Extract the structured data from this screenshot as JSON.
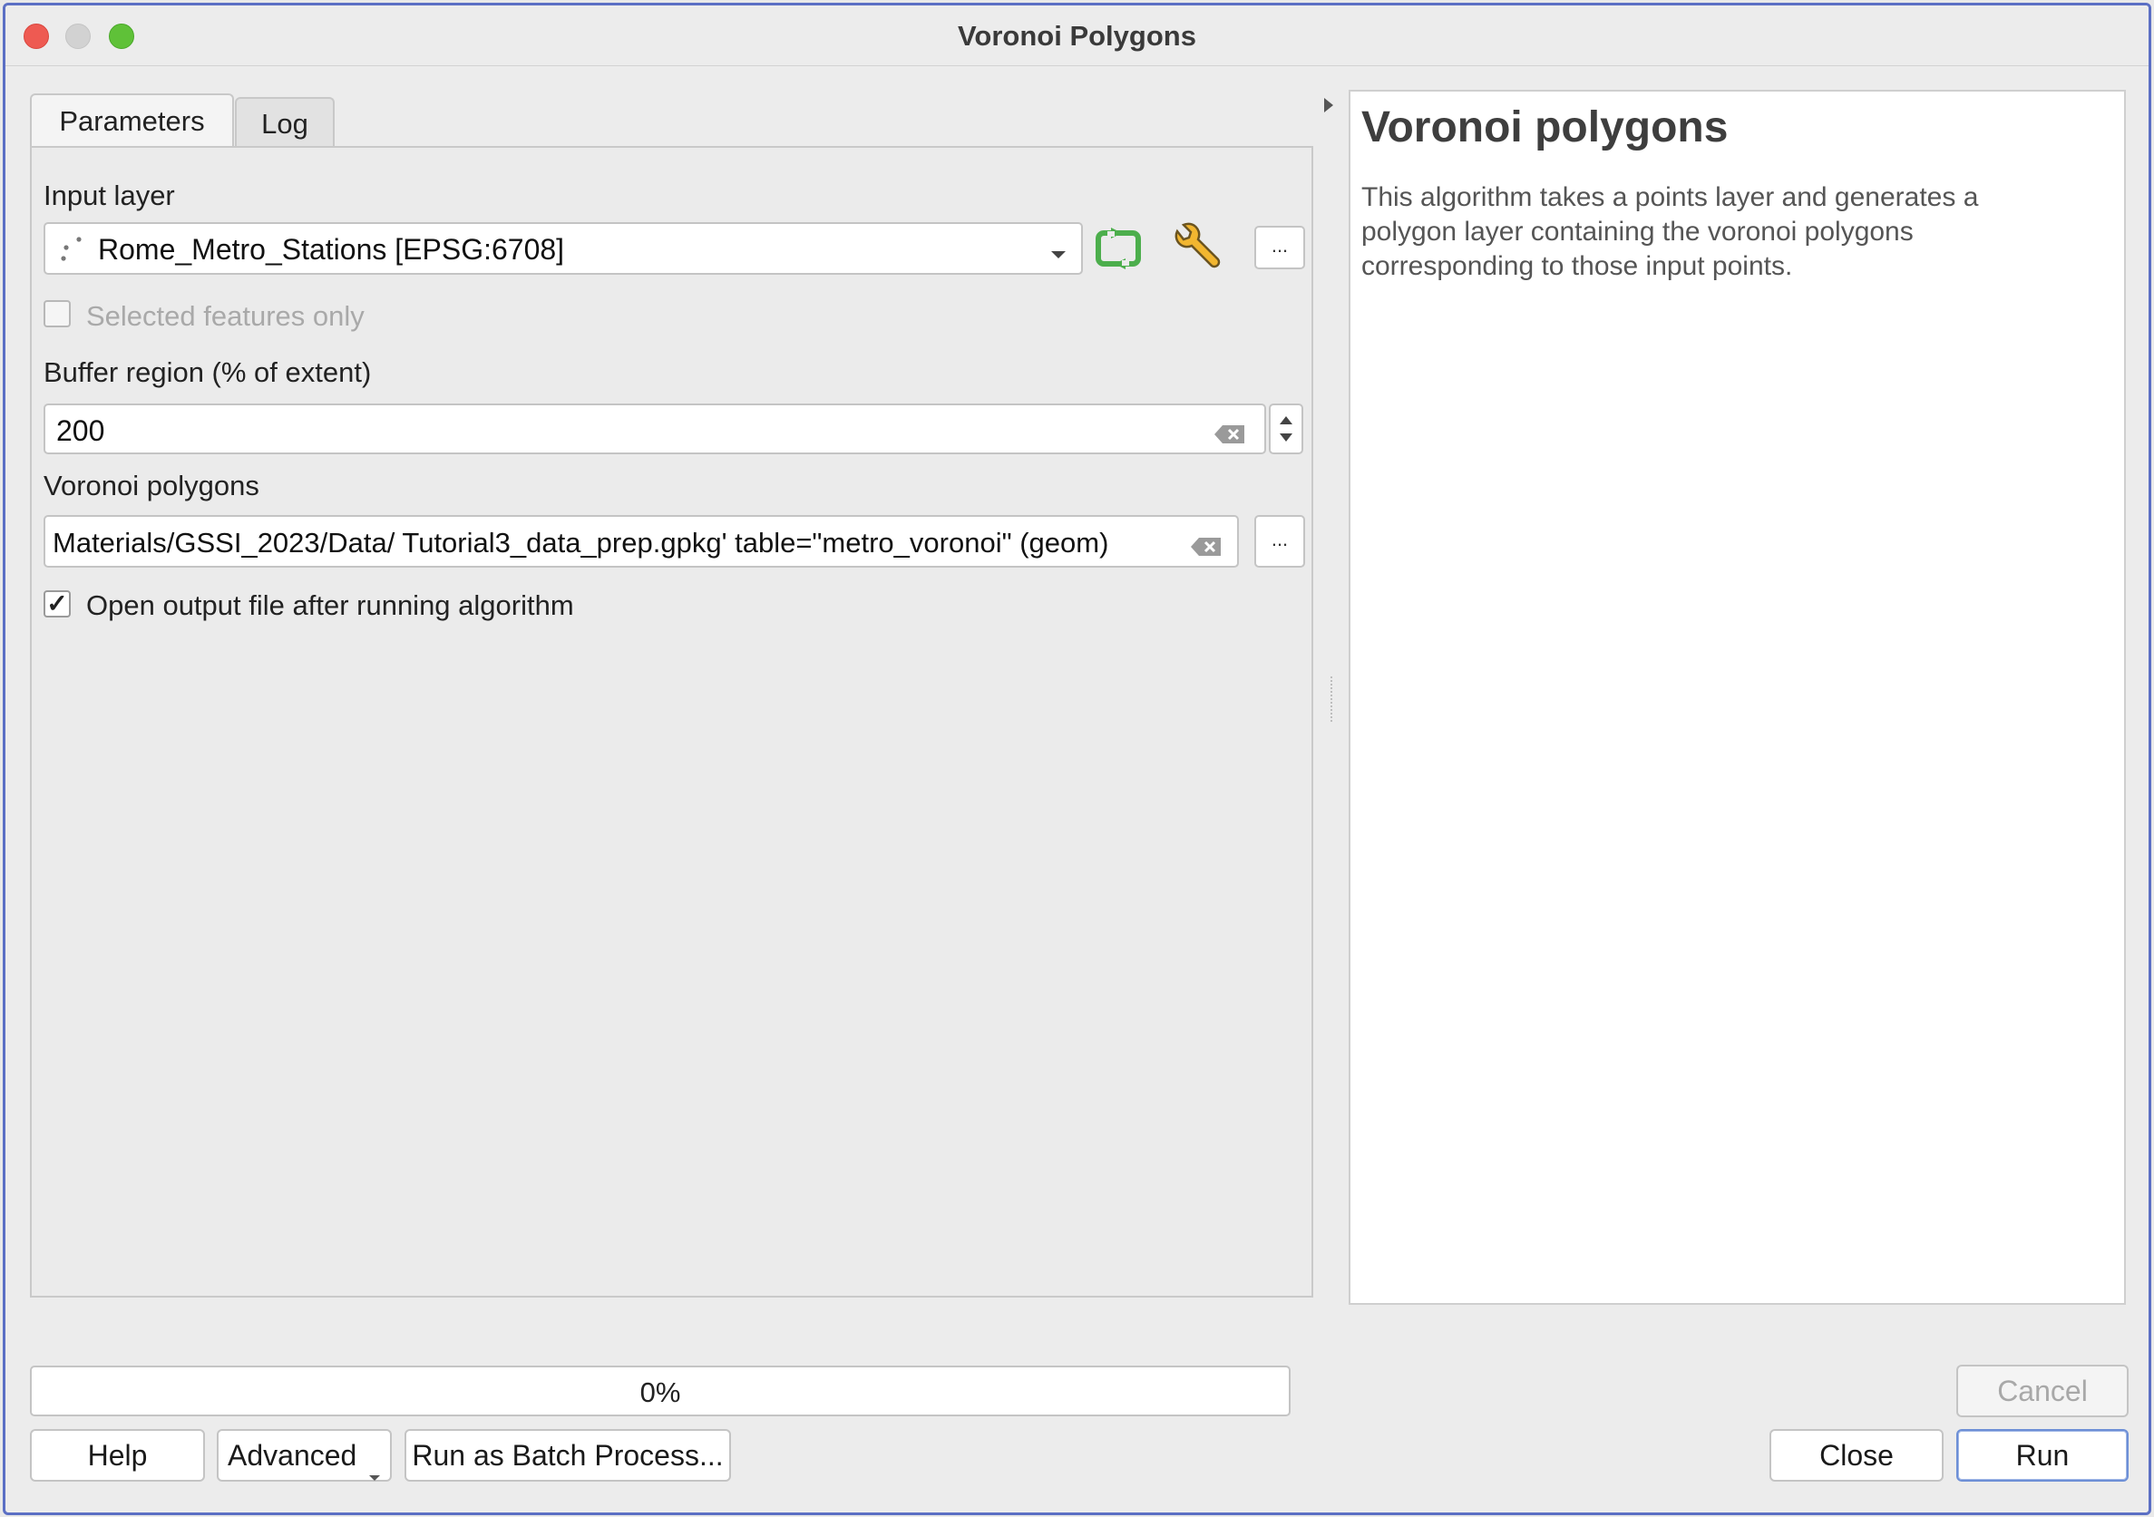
{
  "window": {
    "title": "Voronoi Polygons"
  },
  "tabs": [
    {
      "label": "Parameters",
      "active": true
    },
    {
      "label": "Log",
      "active": false
    }
  ],
  "params": {
    "input_layer_label": "Input layer",
    "input_layer_value": "Rome_Metro_Stations [EPSG:6708]",
    "selected_only_label": "Selected features only",
    "selected_only_checked": false,
    "buffer_label": "Buffer region (% of extent)",
    "buffer_value": "200",
    "output_label": "Voronoi polygons",
    "output_value": "Materials/GSSI_2023/Data/ Tutorial3_data_prep.gpkg' table=\"metro_voronoi\" (geom)",
    "open_output_label": "Open output file after running algorithm",
    "open_output_checked": true,
    "browse_label": "..."
  },
  "help": {
    "title": "Voronoi polygons",
    "description": "This algorithm takes a points layer and generates a polygon layer containing the voronoi polygons corresponding to those input points."
  },
  "progress": {
    "value_percent": 0,
    "text": "0%"
  },
  "buttons": {
    "cancel": "Cancel",
    "help": "Help",
    "advanced": "Advanced",
    "batch": "Run as Batch Process...",
    "close": "Close",
    "run": "Run"
  },
  "icons": {
    "point_layer": "point-layer-icon",
    "iterate": "iterate-icon",
    "settings": "wrench-icon",
    "clear": "clear-icon",
    "dropdown": "chevron-down-icon",
    "spin": "spin-arrows-icon",
    "collapse": "triangle-right-icon"
  },
  "colors": {
    "accent": "#3d7ef0",
    "iterate_green": "#4cae4c",
    "window_border": "#5b6fc4"
  }
}
